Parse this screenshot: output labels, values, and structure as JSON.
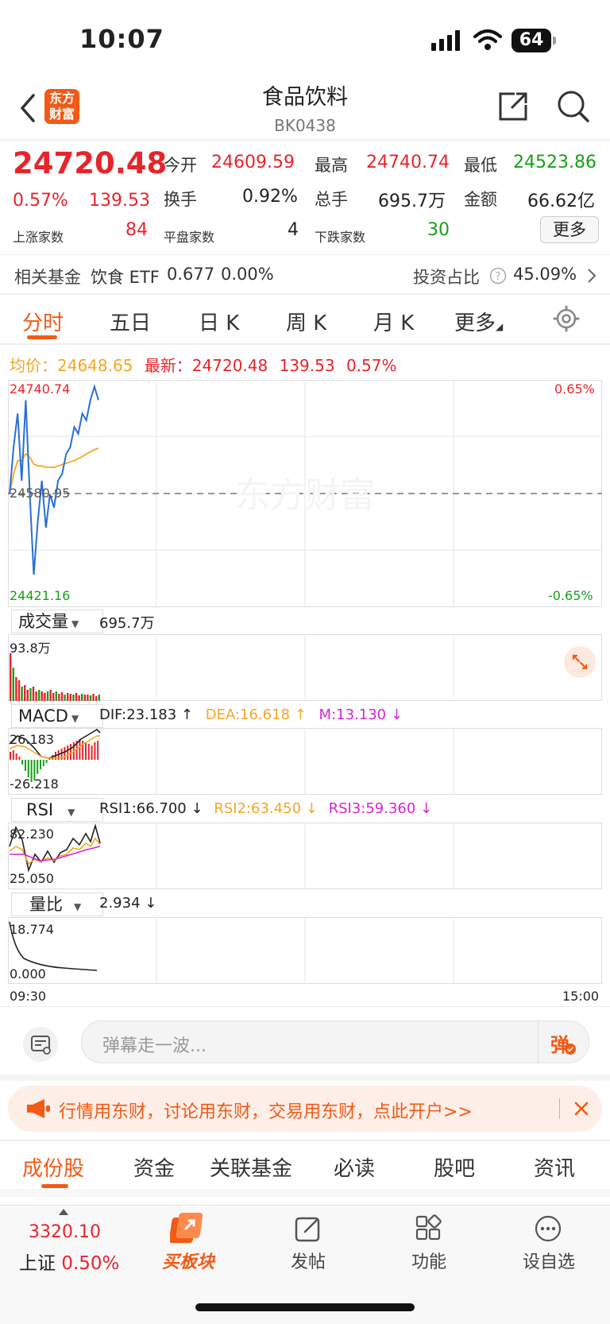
{
  "status_bar": {
    "time": "10:07",
    "battery": "64"
  },
  "header": {
    "title": "食品饮料",
    "code": "BK0438",
    "logo_text": "东方财富"
  },
  "quote": {
    "price": "24720.48",
    "change_pct": "0.57%",
    "change": "139.53",
    "open_label": "今开",
    "open": "24609.59",
    "high_label": "最高",
    "high": "24740.74",
    "low_label": "最低",
    "low": "24523.86",
    "turnover_label": "换手",
    "turnover": "0.92%",
    "volume_label": "总手",
    "volume": "695.7万",
    "amount_label": "金额",
    "amount": "66.62亿",
    "up_label": "上涨家数",
    "up_count": "84",
    "flat_label": "平盘家数",
    "flat_count": "4",
    "down_label": "下跌家数",
    "down_count": "30",
    "more_btn": "更多"
  },
  "fund": {
    "label": "相关基金",
    "name": "饮食 ETF",
    "price": "0.677",
    "change": "0.00%",
    "ratio_label": "投资占比",
    "ratio": "45.09%"
  },
  "chart_tabs": [
    "分时",
    "五日",
    "日 K",
    "周 K",
    "月 K",
    "更多"
  ],
  "chart_info": {
    "avg_label": "均价：",
    "avg": "24648.65",
    "latest_label": "最新：",
    "latest": "24720.48",
    "change": "139.53",
    "change_pct": "0.57%"
  },
  "main_chart": {
    "top": "24740.74",
    "mid": "24580.95",
    "bottom": "24421.16",
    "top_pct": "0.65%",
    "bottom_pct": "-0.65%",
    "watermark": "东方财富"
  },
  "volume_panel": {
    "tab": "成交量",
    "value": "695.7万",
    "max": "93.8万"
  },
  "macd_panel": {
    "tab": "MACD",
    "dif": "DIF:23.183 ↑",
    "dea": "DEA:16.618 ↑",
    "m": "M:13.130 ↓",
    "max": "26.183",
    "min": "-26.218"
  },
  "rsi_panel": {
    "tab": "RSI",
    "rsi1": "RSI1:66.700 ↓",
    "rsi2": "RSI2:63.450 ↓",
    "rsi3": "RSI3:59.360 ↓",
    "max": "82.230",
    "min": "25.050"
  },
  "lb_panel": {
    "tab": "量比",
    "value": "2.934 ↓",
    "max": "18.774",
    "min": "0.000"
  },
  "time_axis": {
    "start": "09:30",
    "end": "15:00"
  },
  "comment": {
    "placeholder": "弹幕走一波...",
    "danmu": "弹"
  },
  "banner": {
    "text": "行情用东财，讨论用东财，交易用东财，点此开户>>"
  },
  "bottom_tabs": [
    "成份股",
    "资金",
    "关联基金",
    "必读",
    "股吧",
    "资讯"
  ],
  "dock": {
    "index_value": "3320.10",
    "index_name": "上证",
    "index_pct": "0.50%",
    "buy": "买板块",
    "post": "发帖",
    "func": "功能",
    "watch": "设自选"
  },
  "colors": {
    "up": "#e8242b",
    "down": "#17a018",
    "accent": "#f25a16",
    "avg": "#f5a623",
    "price_line": "#2a6fd6"
  },
  "chart_data": {
    "type": "line",
    "title": "",
    "xlabel": "",
    "ylabel": "",
    "ylim": [
      24421.16,
      24740.74
    ],
    "x_range": [
      "09:30",
      "15:00"
    ],
    "series": [
      {
        "name": "最新",
        "values": [
          24580,
          24650,
          24700,
          24600,
          24720,
          24580,
          24460,
          24540,
          24600,
          24530,
          24580,
          24560,
          24600,
          24610,
          24640,
          24650,
          24680,
          24670,
          24700,
          24690,
          24720,
          24740,
          24720
        ]
      },
      {
        "name": "均价",
        "values": [
          24580,
          24610,
          24630,
          24630,
          24640,
          24635,
          24625,
          24622,
          24622,
          24620,
          24620,
          24620,
          24622,
          24624,
          24626,
          24628,
          24630,
          24633,
          24636,
          24640,
          24643,
          24646,
          24648.65
        ]
      }
    ]
  }
}
